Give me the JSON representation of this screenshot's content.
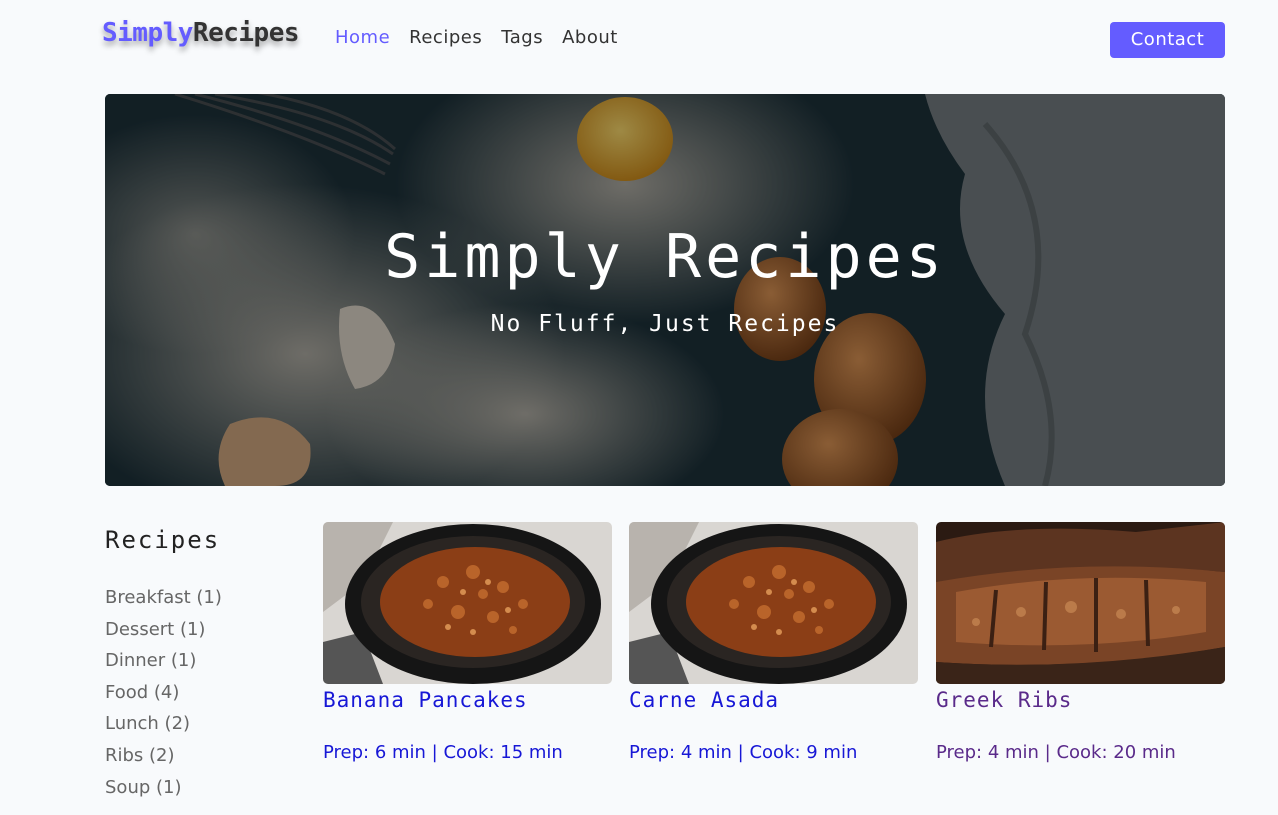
{
  "navbar": {
    "logo_part1": "Simply",
    "logo_part2": "Recipes",
    "links": [
      {
        "label": "Home",
        "active": true
      },
      {
        "label": "Recipes",
        "active": false
      },
      {
        "label": "Tags",
        "active": false
      },
      {
        "label": "About",
        "active": false
      }
    ],
    "contact_label": "Contact",
    "accent_color": "#645cff"
  },
  "hero": {
    "title": "Simply Recipes",
    "subtitle": "No Fluff, Just Recipes"
  },
  "sidebar": {
    "title": "Recipes",
    "tags": [
      "Breakfast (1)",
      "Dessert (1)",
      "Dinner (1)",
      "Food (4)",
      "Lunch (2)",
      "Ribs (2)",
      "Soup (1)"
    ]
  },
  "recipes": [
    {
      "title": "Banana Pancakes",
      "meta": "Prep: 6 min | Cook: 15 min",
      "image": "pan-of-ground-meat"
    },
    {
      "title": "Carne Asada",
      "meta": "Prep: 4 min | Cook: 9 min",
      "image": "pan-of-ground-meat"
    },
    {
      "title": "Greek Ribs",
      "meta": "Prep: 4 min | Cook: 20 min",
      "image": "grilled-ribs"
    }
  ]
}
